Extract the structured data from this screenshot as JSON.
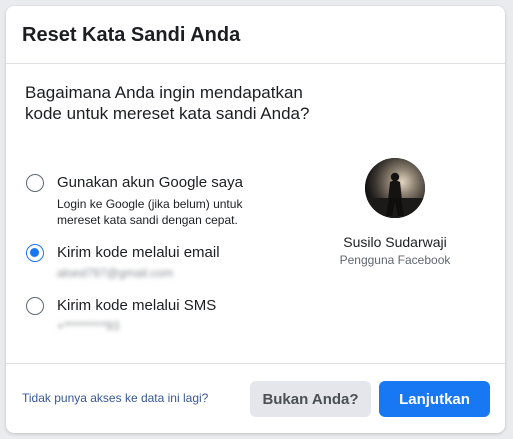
{
  "dialog": {
    "title": "Reset Kata Sandi Anda"
  },
  "body": {
    "question": "Bagaimana Anda ingin mendapatkan kode untuk mereset kata sandi Anda?",
    "options": [
      {
        "label": "Gunakan akun Google saya",
        "description": "Login ke Google (jika belum) untuk mereset kata sandi dengan cepat.",
        "checked": false
      },
      {
        "label": "Kirim kode melalui email",
        "masked_value": "aloed797@gmail.com",
        "checked": true
      },
      {
        "label": "Kirim kode melalui SMS",
        "masked_value": "+*********93",
        "checked": false
      }
    ]
  },
  "profile": {
    "name": "Susilo Sudarwaji",
    "subtitle": "Pengguna Facebook",
    "avatar_icon": "profile-photo"
  },
  "footer": {
    "no_access_link": "Tidak punya akses ke data ini lagi?",
    "not_you_button": "Bukan Anda?",
    "continue_button": "Lanjutkan"
  },
  "colors": {
    "primary": "#1877f2",
    "link": "#385898",
    "secondary_button": "#e4e6eb",
    "text": "#1c1e21"
  }
}
